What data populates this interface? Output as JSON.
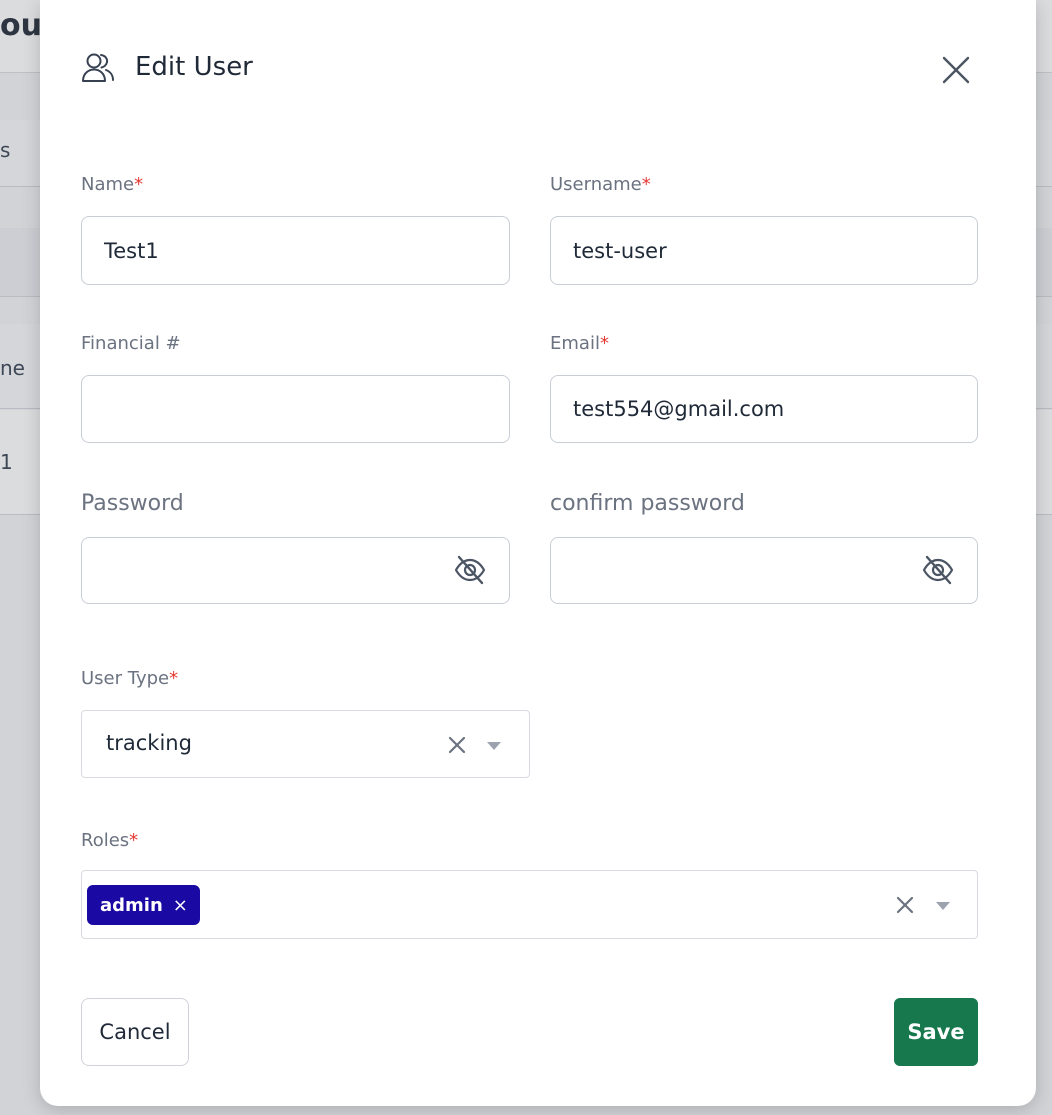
{
  "background": {
    "title_fragment": "ou",
    "row_fragments": [
      "s",
      "ne",
      "1"
    ]
  },
  "modal": {
    "title": "Edit User",
    "header_icon": "users-icon",
    "close_icon": "close-icon"
  },
  "form": {
    "name": {
      "label": "Name",
      "required_mark": "*",
      "value": ""
    },
    "username": {
      "label": "Username",
      "required_mark": "*",
      "value": "test-user"
    },
    "financial": {
      "label": "Financial #",
      "value": ""
    },
    "email": {
      "label": "Email",
      "required_mark": "*",
      "value": "test554@gmail.com"
    },
    "password": {
      "label": "Password",
      "value": "",
      "toggle_icon": "eye-off-icon"
    },
    "confirm_password": {
      "label": "confirm password",
      "value": "",
      "toggle_icon": "eye-off-icon"
    },
    "user_type": {
      "label": "User Type",
      "required_mark": "*",
      "selected": "tracking"
    },
    "roles": {
      "label": "Roles",
      "required_mark": "*",
      "chips": [
        "admin"
      ],
      "chip_remove": "×"
    }
  },
  "name_value": "Test1",
  "actions": {
    "cancel_label": "Cancel",
    "save_label": "Save"
  },
  "colors": {
    "save_button": "#17784d",
    "chip": "#1a0aa3",
    "required": "#e53935"
  }
}
